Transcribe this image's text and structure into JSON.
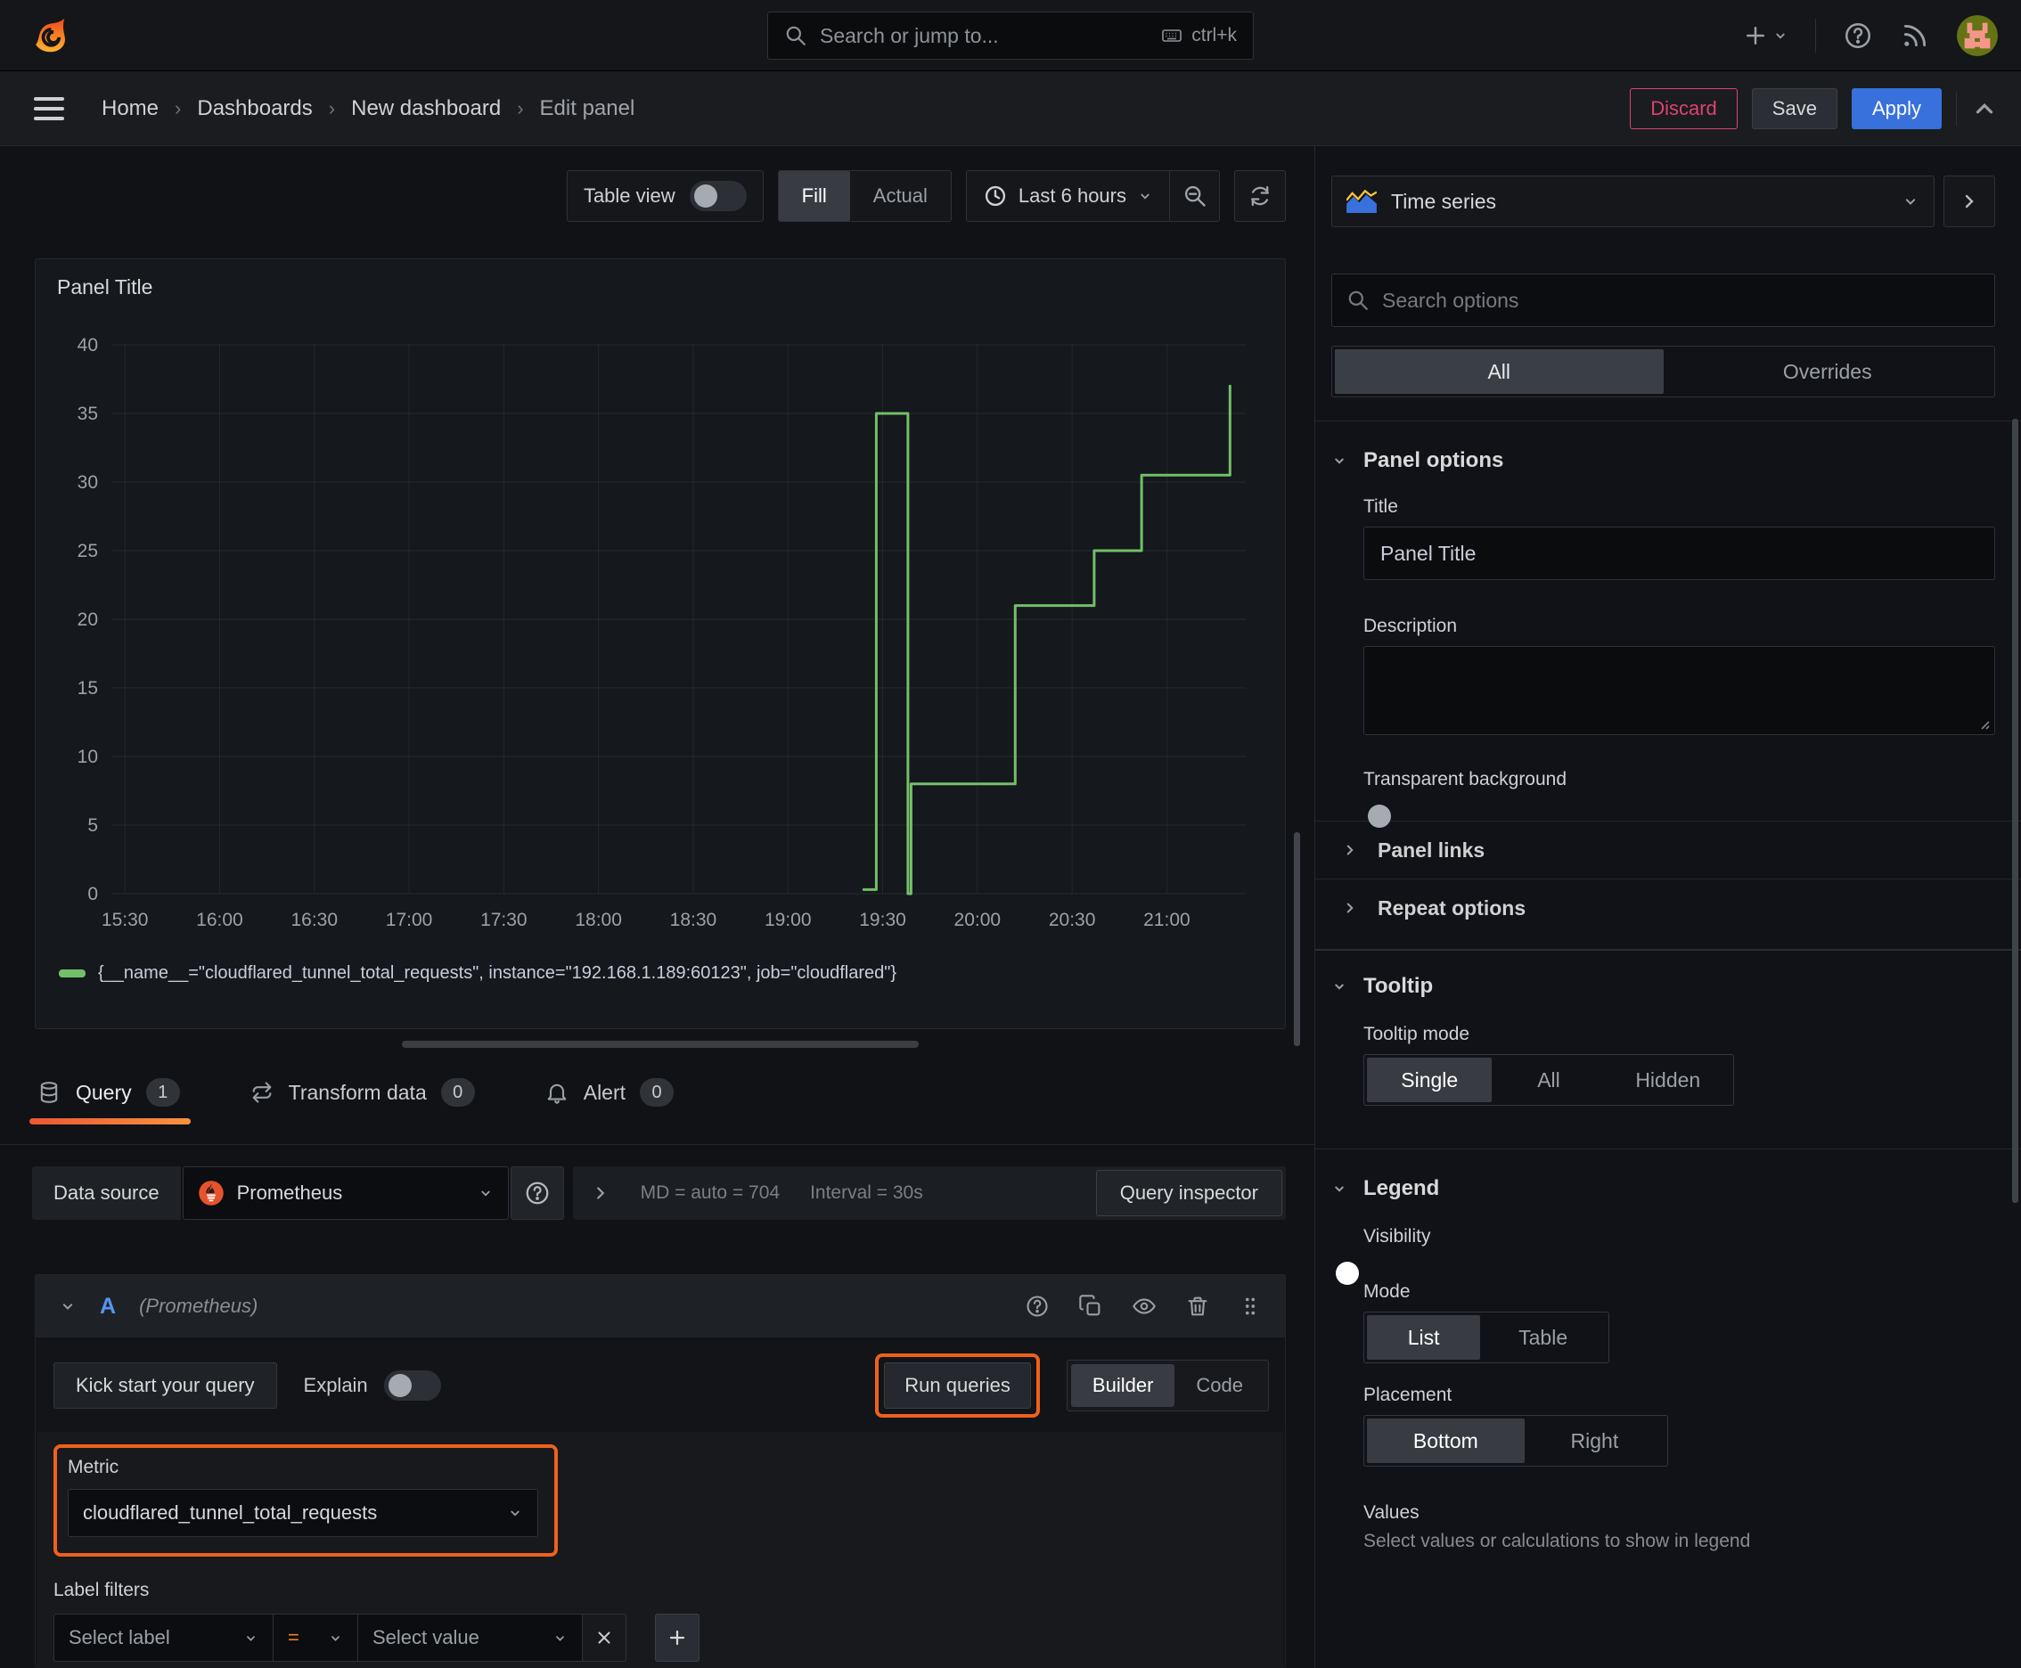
{
  "topbar": {
    "search_placeholder": "Search or jump to...",
    "shortcut": "ctrl+k"
  },
  "breadcrumb": {
    "items": [
      "Home",
      "Dashboards",
      "New dashboard",
      "Edit panel"
    ]
  },
  "actions": {
    "discard": "Discard",
    "save": "Save",
    "apply": "Apply"
  },
  "toolbar": {
    "table_view": "Table view",
    "fill": "Fill",
    "actual": "Actual",
    "time_range": "Last 6 hours"
  },
  "panel": {
    "title": "Panel Title",
    "legend": "{__name__=\"cloudflared_tunnel_total_requests\", instance=\"192.168.1.189:60123\", job=\"cloudflared\"}"
  },
  "chart_data": {
    "type": "line",
    "title": "Panel Title",
    "x_ticks": [
      "15:30",
      "16:00",
      "16:30",
      "17:00",
      "17:30",
      "18:00",
      "18:30",
      "19:00",
      "19:30",
      "20:00",
      "20:30",
      "21:00"
    ],
    "x_domain": [
      "15:26",
      "21:25"
    ],
    "y_ticks": [
      0,
      5,
      10,
      15,
      20,
      25,
      30,
      35,
      40
    ],
    "ylim": [
      0,
      40
    ],
    "grid": true,
    "legend_position": "bottom",
    "series": [
      {
        "name": "{__name__=\"cloudflared_tunnel_total_requests\", instance=\"192.168.1.189:60123\", job=\"cloudflared\"}",
        "color": "#73bf69",
        "points": [
          [
            "19:24",
            0.3
          ],
          [
            "19:28",
            0.3
          ],
          [
            "19:28",
            35
          ],
          [
            "19:38",
            35
          ],
          [
            "19:38",
            0
          ],
          [
            "19:39",
            0
          ],
          [
            "19:39",
            8
          ],
          [
            "20:12",
            8
          ],
          [
            "20:12",
            21
          ],
          [
            "20:37",
            21
          ],
          [
            "20:37",
            25
          ],
          [
            "20:52",
            25
          ],
          [
            "20:52",
            30.5
          ],
          [
            "21:20",
            30.5
          ],
          [
            "21:20",
            37
          ]
        ]
      }
    ]
  },
  "tabs": {
    "query": "Query",
    "query_count": "1",
    "transform": "Transform data",
    "transform_count": "0",
    "alert": "Alert",
    "alert_count": "0"
  },
  "datasource": {
    "label": "Data source",
    "name": "Prometheus",
    "md": "MD = auto = 704",
    "interval": "Interval = 30s",
    "inspector": "Query inspector"
  },
  "query_editor": {
    "ref_id": "A",
    "ds_hint": "(Prometheus)",
    "kick_start": "Kick start your query",
    "explain": "Explain",
    "run_queries": "Run queries",
    "builder": "Builder",
    "code": "Code",
    "metric_label": "Metric",
    "metric_value": "cloudflared_tunnel_total_requests",
    "label_filters": "Label filters",
    "select_label": "Select label",
    "operator": "=",
    "select_value": "Select value"
  },
  "sidebar": {
    "viz_name": "Time series",
    "search_placeholder": "Search options",
    "tab_all": "All",
    "tab_overrides": "Overrides",
    "panel_options": {
      "heading": "Panel options",
      "title_label": "Title",
      "title_value": "Panel Title",
      "description_label": "Description",
      "transparent_label": "Transparent background"
    },
    "links": "Panel links",
    "repeat": "Repeat options",
    "tooltip": {
      "heading": "Tooltip",
      "mode_label": "Tooltip mode",
      "options": [
        "Single",
        "All",
        "Hidden"
      ],
      "active": "Single"
    },
    "legend": {
      "heading": "Legend",
      "visibility": "Visibility",
      "mode": "Mode",
      "mode_options": [
        "List",
        "Table"
      ],
      "placement": "Placement",
      "placement_options": [
        "Bottom",
        "Right"
      ],
      "values_label": "Values",
      "values_help": "Select values or calculations to show in legend"
    }
  },
  "colors": {
    "accent_blue": "#3871dc",
    "highlight_orange": "#f0601c",
    "series_green": "#73bf69",
    "discard_pink": "#e0426d",
    "prometheus_orange": "#e6522c"
  }
}
